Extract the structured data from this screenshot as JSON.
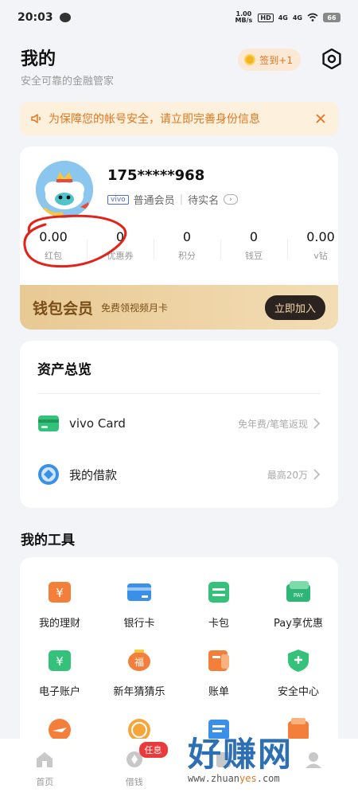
{
  "status_bar": {
    "time": "20:03",
    "speed": "1.00 MB/s",
    "net1": "4G",
    "net2": "4G",
    "battery": "66"
  },
  "header": {
    "title": "我的",
    "subtitle": "安全可靠的金融管家",
    "signin_label": "签到+1"
  },
  "notice": {
    "text": "为保障您的帐号安全，请立即完善身份信息"
  },
  "profile": {
    "phone": "175*****968",
    "brand_tag": "vivo",
    "member_level": "普通会员",
    "verify_status": "待实名",
    "stats": [
      {
        "value": "0.00",
        "label": "红包"
      },
      {
        "value": "0",
        "label": "优惠券"
      },
      {
        "value": "0",
        "label": "积分"
      },
      {
        "value": "0",
        "label": "钱豆"
      },
      {
        "value": "0.00",
        "label": "v钻"
      }
    ],
    "vip": {
      "title": "钱包会员",
      "subtitle": "免费领视频月卡",
      "button": "立即加入"
    }
  },
  "assets": {
    "title": "资产总览",
    "rows": [
      {
        "label": "vivo Card",
        "hint": "免年费/笔笔返现"
      },
      {
        "label": "我的借款",
        "hint": "最高20万"
      }
    ]
  },
  "tools": {
    "title": "我的工具",
    "items": [
      {
        "label": "我的理财"
      },
      {
        "label": "银行卡"
      },
      {
        "label": "卡包"
      },
      {
        "label": "Pay享优惠"
      },
      {
        "label": "电子账户"
      },
      {
        "label": "新年猜猜乐"
      },
      {
        "label": "账单"
      },
      {
        "label": "安全中心"
      }
    ]
  },
  "nav": {
    "items": [
      {
        "label": "首页"
      },
      {
        "label": "借钱"
      },
      {
        "label": ""
      },
      {
        "label": ""
      }
    ],
    "badge": "任息"
  },
  "watermark": {
    "main": "好赚网",
    "url_pre": "www.zhuan",
    "url_hl": "yes",
    "url_post": ".com"
  },
  "colors": {
    "accent_orange": "#e07720",
    "vip_gold": "#e8c994",
    "badge_red": "#ea3a3a",
    "brand_blue": "#4b6ed6"
  }
}
